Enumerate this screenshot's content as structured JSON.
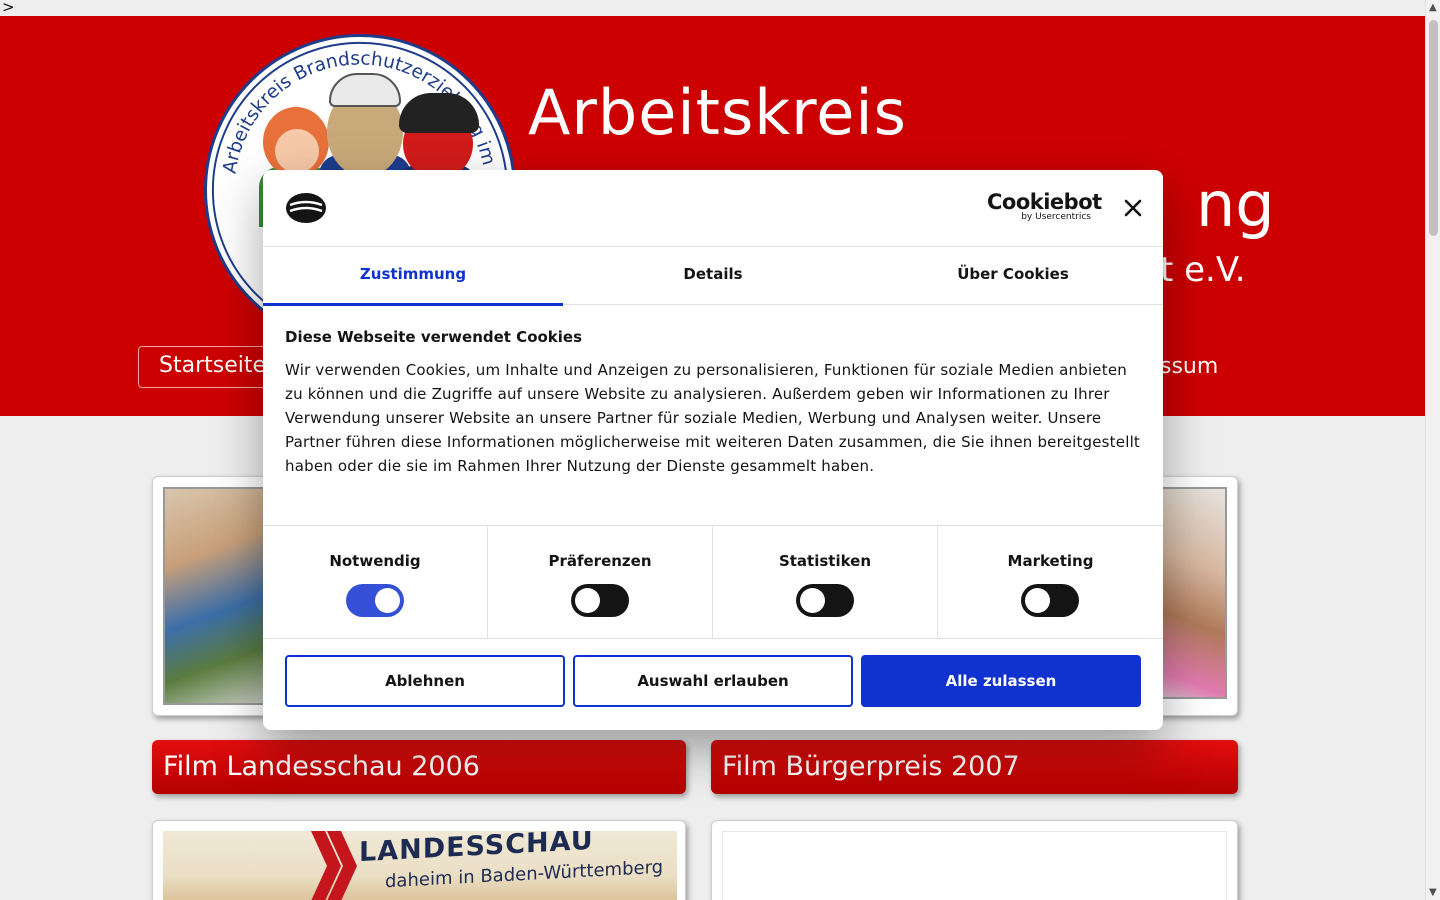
{
  "stray_char": ">",
  "header": {
    "title_line1": "Arbeitskreis",
    "title_line2_visible": "ng",
    "title_line3_visible": "t e.V.",
    "logo_text": "Arbeitskreis Brandschutzerziehung im Stadtfeuerwehrverb",
    "nav": {
      "start_label": "Startseite",
      "impressum_visible": "ssum"
    }
  },
  "content": {
    "band_left": "Film Landesschau 2006",
    "band_right": "Film Bürgerpreis 2007",
    "landesschau_title": "LANDESSCHAU",
    "landesschau_sub": "daheim in Baden-Württemberg"
  },
  "cookie_dialog": {
    "brand": "Cookiebot",
    "brand_sub": "by Usercentrics",
    "tabs": [
      {
        "label": "Zustimmung",
        "active": true
      },
      {
        "label": "Details",
        "active": false
      },
      {
        "label": "Über Cookies",
        "active": false
      }
    ],
    "title": "Diese Webseite verwendet Cookies",
    "text": "Wir verwenden Cookies, um Inhalte und Anzeigen zu personalisieren, Funktionen für soziale Medien anbieten zu können und die Zugriffe auf unsere Website zu analysieren. Außerdem geben wir Informationen zu Ihrer Verwendung unserer Website an unsere Partner für soziale Medien, Werbung und Analysen weiter. Unsere Partner führen diese Informationen möglicherweise mit weiteren Daten zusammen, die Sie ihnen bereitgestellt haben oder die sie im Rahmen Ihrer Nutzung der Dienste gesammelt haben.",
    "toggles": [
      {
        "label": "Notwendig",
        "on": true
      },
      {
        "label": "Präferenzen",
        "on": false
      },
      {
        "label": "Statistiken",
        "on": false
      },
      {
        "label": "Marketing",
        "on": false
      }
    ],
    "buttons": {
      "decline": "Ablehnen",
      "allow_selection": "Auswahl erlauben",
      "allow_all": "Alle zulassen"
    },
    "colors": {
      "accent": "#1032cf",
      "header_red": "#cc0000"
    }
  }
}
